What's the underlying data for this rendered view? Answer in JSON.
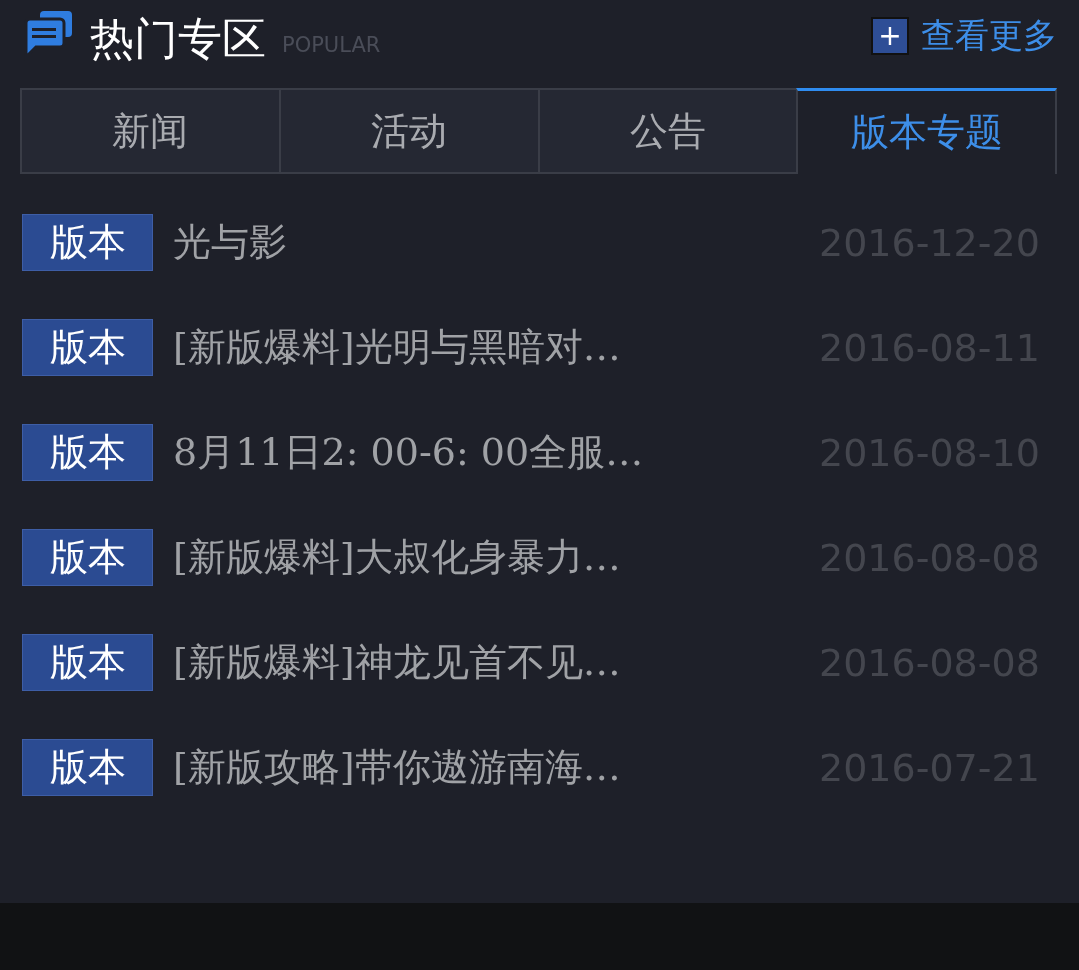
{
  "header": {
    "title": "热门专区",
    "subtitle": "POPULAR",
    "more_link": {
      "icon": "+",
      "label": "查看更多"
    }
  },
  "tabs": [
    {
      "label": "新闻",
      "selected": false
    },
    {
      "label": "活动",
      "selected": false
    },
    {
      "label": "公告",
      "selected": false
    },
    {
      "label": "版本专题",
      "selected": true
    }
  ],
  "articles": [
    {
      "tag": "版本",
      "title": "光与影",
      "date": "2016-12-20"
    },
    {
      "tag": "版本",
      "title": "[新版爆料]光明与黑暗对…",
      "date": "2016-08-11"
    },
    {
      "tag": "版本",
      "title": "8月11日2:  00-6:  00全服…",
      "date": "2016-08-10"
    },
    {
      "tag": "版本",
      "title": "[新版爆料]大叔化身暴力…",
      "date": "2016-08-08"
    },
    {
      "tag": "版本",
      "title": "[新版爆料]神龙见首不见…",
      "date": "2016-08-08"
    },
    {
      "tag": "版本",
      "title": "[新版攻略]带你遨游南海…",
      "date": "2016-07-21"
    }
  ]
}
